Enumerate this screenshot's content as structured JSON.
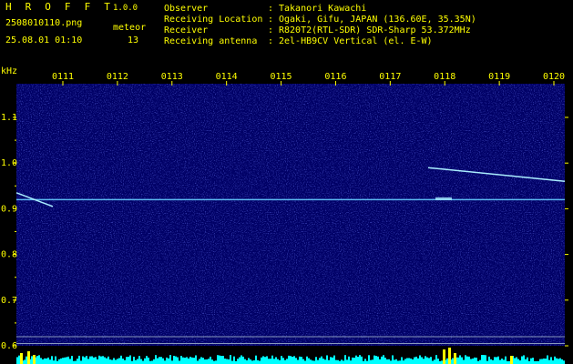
{
  "header": {
    "app_name": "H R O F F T",
    "version": "1.0.0",
    "file_name": "2508010110.png",
    "timestamp": "25.08.01 01:10",
    "meteor_label": "meteor",
    "meteor_count": "13"
  },
  "station": {
    "rows": [
      {
        "key": "Observer",
        "value": "Takanori Kawachi"
      },
      {
        "key": "Receiving Location",
        "value": "Ogaki, Gifu, JAPAN (136.60E, 35.35N)"
      },
      {
        "key": "Receiver",
        "value": "R820T2(RTL-SDR) SDR-Sharp 53.372MHz"
      },
      {
        "key": "Receiving antenna",
        "value": "2el-HB9CV Vertical (el. E-W)"
      }
    ]
  },
  "chart_data": {
    "type": "heatmap",
    "y_unit": "kHz",
    "x_ticks": [
      "0111",
      "0112",
      "0113",
      "0114",
      "0115",
      "0116",
      "0117",
      "0118",
      "0119",
      "0120"
    ],
    "y_ticks": [
      "1.1",
      "1.0",
      "0.9",
      "0.8",
      "0.7",
      "0.6"
    ],
    "ylim": [
      0.6,
      1.15
    ],
    "colors": {
      "axis": "#ffff00",
      "background": "#000066",
      "noise": "#3344dd",
      "carrier": "#66ccff",
      "echo": "#aaeeff",
      "level": "#00ffff",
      "peak": "#ffff00"
    }
  }
}
